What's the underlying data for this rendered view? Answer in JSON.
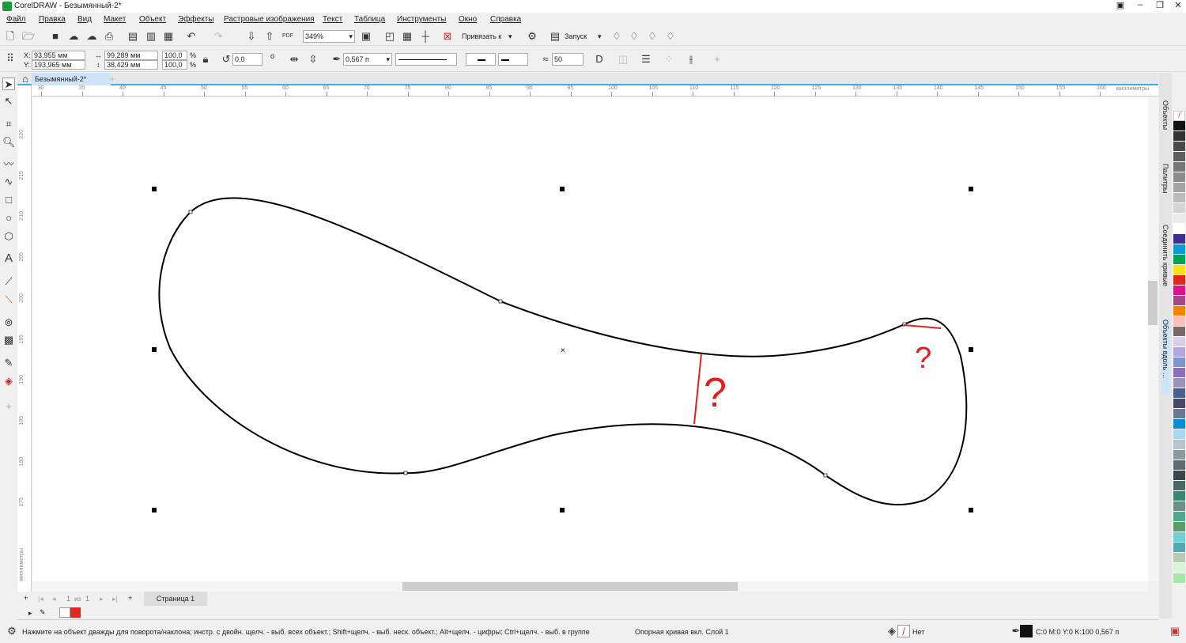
{
  "window": {
    "title": "CorelDRAW - Безымянный-2*"
  },
  "menu": [
    "Файл",
    "Правка",
    "Вид",
    "Макет",
    "Объект",
    "Эффекты",
    "Растровые изображения",
    "Текст",
    "Таблица",
    "Инструменты",
    "Окно",
    "Справка"
  ],
  "toolbar": {
    "zoom": "349%",
    "snap_label": "Привязать к",
    "launch_label": "Запуск"
  },
  "property_bar": {
    "x_label": "X:",
    "x": "93,955 мм",
    "y_label": "Y:",
    "y": "193,965 мм",
    "width": "99,289 мм",
    "height": "38,429 мм",
    "scale_x": "100,0",
    "scale_y": "100,0",
    "percent": "%",
    "rotation": "0,0",
    "degree": "o",
    "outline_width": "0,567 п",
    "smoothing": "50"
  },
  "document_tab": "Безымянный-2*",
  "ruler": {
    "h_ticks": [
      "30",
      "35",
      "40",
      "45",
      "50",
      "55",
      "60",
      "65",
      "70",
      "75",
      "80",
      "85",
      "90",
      "95",
      "100",
      "105",
      "110",
      "115",
      "120",
      "125",
      "130",
      "135",
      "140",
      "145",
      "150",
      "155",
      "160"
    ],
    "h_unit": "миллиметры",
    "v_ticks": [
      "220",
      "215",
      "210",
      "205",
      "200",
      "195",
      "190",
      "185",
      "180",
      "175"
    ],
    "v_unit": "миллиметры"
  },
  "canvas": {
    "annotation_big": "?",
    "annotation_small": "?",
    "curve_color": "#000000",
    "annotation_color": "#e02020"
  },
  "page_nav": {
    "current": "1",
    "of": "из",
    "total": "1",
    "page_tab": "Страница 1"
  },
  "dockers": [
    "Объекты",
    "Палитры",
    "Соединить кривые",
    "Объекты вдоль ..."
  ],
  "palette": [
    "#111111",
    "#333333",
    "#4a4a4a",
    "#5e5e5e",
    "#777777",
    "#8c8c8c",
    "#a3a3a3",
    "#bcbcbc",
    "#d4d4d4",
    "#eaeaea",
    "#ffffff",
    "#3a2f93",
    "#0e9ad7",
    "#00a15a",
    "#f9e11a",
    "#e0261f",
    "#e0118a",
    "#a8448a",
    "#f28400",
    "#ffbdbd",
    "#7a6a63",
    "#d6d0ee",
    "#b3a6de",
    "#7b93cf",
    "#8a6fc0",
    "#9a93b8",
    "#465f8c",
    "#4a4866",
    "#697894",
    "#0a8ecf",
    "#a9d7f1",
    "#b6c4cc",
    "#8c9aa0",
    "#5f6b70",
    "#3d4447",
    "#4a6964",
    "#3c8772",
    "#6a9088",
    "#4ea88e",
    "#5a9c6a",
    "#6fd0d8",
    "#53a9b0",
    "#b8c9b8",
    "#d8f5d8",
    "#a5e8a5"
  ],
  "status": {
    "hint": "Нажмите на объект дважды для поворота/наклона; инстр. с двойн. щелч. - выб. всех объект.; Shift+щелч. - выб. неск. объект.; Alt+щелч. - цифры; Ctrl+щелч. - выб. в группе",
    "object_info": "Опорная кривая вкл. Слой 1",
    "fill": "Нет",
    "outline": "C:0 M:0 Y:0 K:100  0,567 п"
  }
}
